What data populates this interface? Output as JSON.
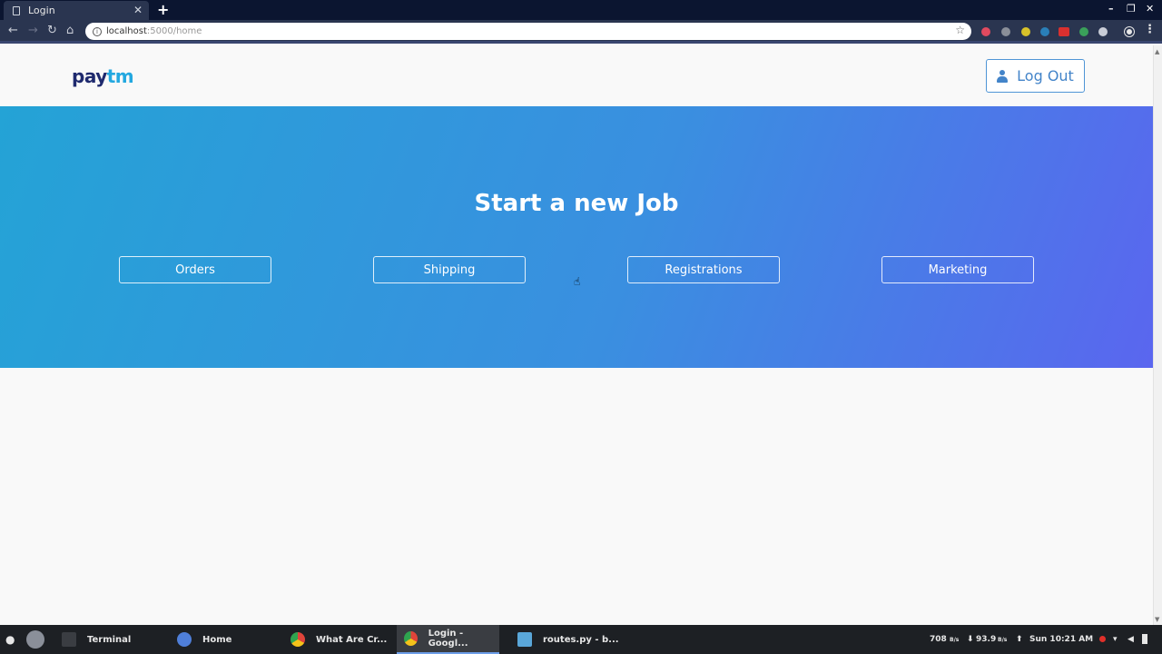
{
  "browser": {
    "tab_title": "Login",
    "new_tab": "+",
    "url_host": "localhost",
    "url_path": ":5000/home"
  },
  "page": {
    "brand_pay": "pay",
    "brand_tm": "tm",
    "logout_label": "Log Out",
    "hero_title": "Start a new Job",
    "jobs": [
      "Orders",
      "Shipping",
      "Registrations",
      "Marketing"
    ]
  },
  "taskbar": {
    "items": [
      "Terminal",
      "Home",
      "What Are Cr...",
      "Login - Googl...",
      "routes.py - b..."
    ],
    "net_up": "708",
    "net_up_unit": "B/s",
    "net_down": "93.9",
    "net_down_unit": "B/s",
    "clock": "Sun 10:21 AM"
  },
  "colors": {
    "brand_dark": "#1f2a6e",
    "brand_light": "#23a8e0",
    "hero_start": "#24a3d6",
    "hero_end": "#5a66ef"
  }
}
